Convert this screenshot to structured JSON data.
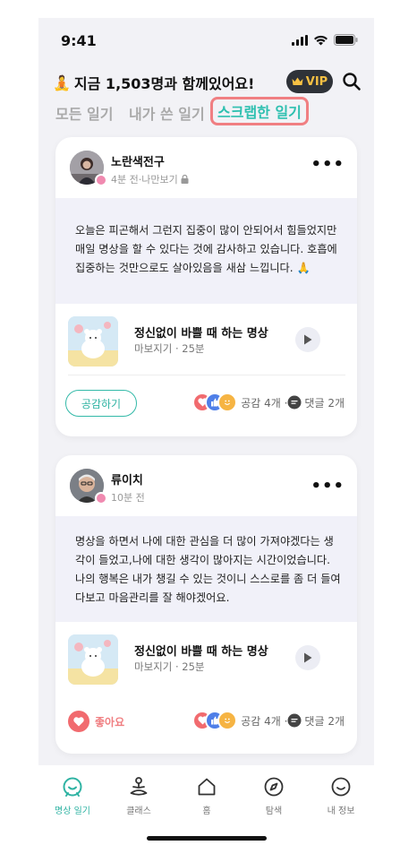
{
  "status_bar": {
    "time": "9:41"
  },
  "header": {
    "title_emoji": "🧘",
    "title": "지금 1,503명과 함께있어요!",
    "vip_label": "VIP"
  },
  "tabs": [
    {
      "label": "모든 일기",
      "active": false
    },
    {
      "label": "내가 쓴 일기",
      "active": false
    },
    {
      "label": "스크랩한 일기",
      "active": true
    }
  ],
  "posts": [
    {
      "author": "노란색전구",
      "meta": "4분 전·나만보기",
      "locked": true,
      "body": "오늘은 피곤해서 그런지 집중이 많이 안되어서 힘들었지만 매일 명상을 할 수 있다는 것에 감사하고 있습니다. 호흡에 집중하는 것만으로도 살아있음을 새삼 느낍니다. 🙏",
      "meditation": {
        "title": "정신없이 바쁠 때 하는 명상",
        "subtitle": "마보지기 · 25분"
      },
      "action_label": "공감하기",
      "reactions_label": "공감 4개 · ",
      "comments_label": "댓글 2개"
    },
    {
      "author": "류이치",
      "meta": "10분 전",
      "locked": false,
      "body": "명상을 하면서 나에 대한 관심을 더 많이 가져야겠다는 생각이 들었고,나에 대한 생각이 많아지는 시간이었습니다. 나의 행복은 내가 챙길 수 있는 것이니 스스로를 좀 더 들여다보고 마음관리를 잘 해야겠어요.",
      "meditation": {
        "title": "정신없이 바쁠 때 하는 명상",
        "subtitle": "마보지기 · 25분"
      },
      "action_label": "좋아요",
      "reactions_label": "공감 4개 · ",
      "comments_label": "댓글 2개"
    }
  ],
  "bottom_nav": [
    {
      "label": "명상 일기",
      "icon": "journal-smile-icon",
      "active": true
    },
    {
      "label": "클래스",
      "icon": "meditation-person-icon",
      "active": false
    },
    {
      "label": "홈",
      "icon": "home-icon",
      "active": false
    },
    {
      "label": "탐색",
      "icon": "compass-icon",
      "active": false
    },
    {
      "label": "내 정보",
      "icon": "profile-smile-icon",
      "active": false
    }
  ],
  "colors": {
    "accent": "#2fc0b0",
    "highlight_border": "#f07f82",
    "vip_bg": "#2e3238",
    "vip_text": "#f5c043"
  }
}
